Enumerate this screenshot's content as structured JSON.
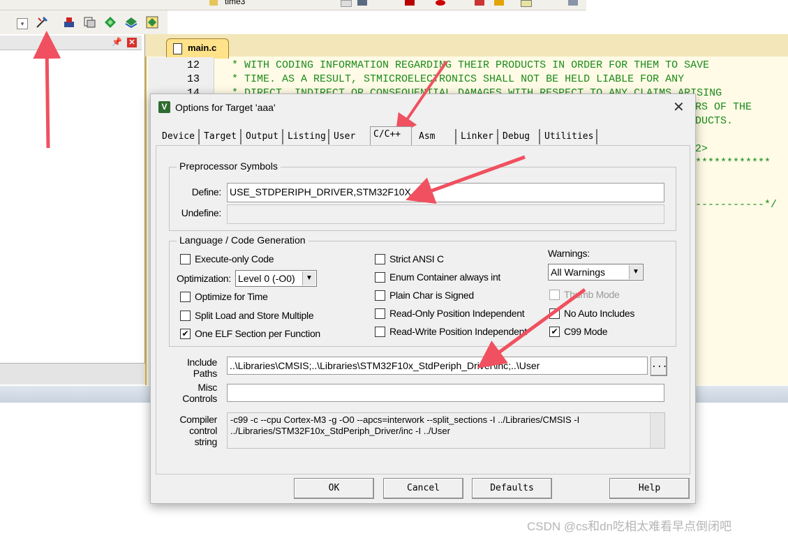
{
  "toolbar": {
    "target_name": "time3",
    "icons": [
      "options-for-target-icon",
      "load-icon",
      "translate-icon",
      "diamond-icon",
      "stack-icon"
    ]
  },
  "left_panel": {
    "pin": "ᵖ",
    "close": "✕"
  },
  "editor": {
    "tab_label": "main.c",
    "line_numbers": [
      "12",
      "13",
      "14"
    ],
    "lines": [
      "* WITH CODING INFORMATION REGARDING THEIR PRODUCTS IN ORDER FOR THEM TO SAVE",
      "* TIME. AS A RESULT, STMICROELECTRONICS SHALL NOT BE HELD LIABLE FOR ANY",
      "* DIRECT, INDIRECT OR CONSEQUENTIAL DAMAGES WITH RESPECT TO ANY CLAIMS ARISING"
    ],
    "right_fragments": [
      "RS OF THE",
      "DUCTS.",
      "2>",
      "************",
      "-----------*/"
    ]
  },
  "dialog": {
    "title": "Options for Target 'aaa'",
    "close": "✕",
    "tabs": [
      "Device",
      "Target",
      "Output",
      "Listing",
      "User",
      "C/C++",
      "Asm",
      "Linker",
      "Debug",
      "Utilities"
    ],
    "active_tab": "C/C++",
    "preprocessor": {
      "group": "Preprocessor Symbols",
      "define_label": "Define:",
      "define_value": "USE_STDPERIPH_DRIVER,STM32F10X_HD",
      "undefine_label": "Undefine:",
      "undefine_value": ""
    },
    "language": {
      "group": "Language / Code Generation",
      "execute_only": {
        "label": "Execute-only Code",
        "checked": false
      },
      "optimization_label": "Optimization:",
      "optimization_value": "Level 0 (-O0)",
      "optimize_time": {
        "label": "Optimize for Time",
        "checked": false
      },
      "split_load": {
        "label": "Split Load and Store Multiple",
        "checked": false
      },
      "one_elf": {
        "label": "One ELF Section per Function",
        "checked": true
      },
      "strict_ansi": {
        "label": "Strict ANSI C",
        "checked": false
      },
      "enum_container": {
        "label": "Enum Container always int",
        "checked": false
      },
      "plain_char": {
        "label": "Plain Char is Signed",
        "checked": false
      },
      "ro_pi": {
        "label": "Read-Only Position Independent",
        "checked": false
      },
      "rw_pi": {
        "label": "Read-Write Position Independent",
        "checked": false
      },
      "warnings_label": "Warnings:",
      "warnings_value": "All Warnings",
      "thumb_mode": {
        "label": "Thumb Mode",
        "checked": false,
        "disabled": true
      },
      "no_auto_includes": {
        "label": "No Auto Includes",
        "checked": false
      },
      "c99_mode": {
        "label": "C99 Mode",
        "checked": true
      }
    },
    "include_paths_label_1": "Include",
    "include_paths_label_2": "Paths",
    "include_paths_value": "..\\Libraries\\CMSIS;..\\Libraries\\STM32F10x_StdPeriph_Driver\\inc;..\\User",
    "browse_label": "...",
    "misc_label_1": "Misc",
    "misc_label_2": "Controls",
    "misc_value": "",
    "compiler_label_1": "Compiler",
    "compiler_label_2": "control",
    "compiler_label_3": "string",
    "compiler_line_1": "-c99 -c --cpu Cortex-M3 -g -O0 --apcs=interwork --split_sections -I ../Libraries/CMSIS -I",
    "compiler_line_2": "../Libraries/STM32F10x_StdPeriph_Driver/inc -I ../User",
    "buttons": {
      "ok": "OK",
      "cancel": "Cancel",
      "defaults": "Defaults",
      "help": "Help"
    }
  },
  "watermark": "CSDN @cs和dn吃相太难看早点倒闭吧",
  "colors": {
    "annotation_arrow": "#f0505f",
    "code_comment": "#1a8a1a",
    "editor_bg": "#fffbe6"
  }
}
